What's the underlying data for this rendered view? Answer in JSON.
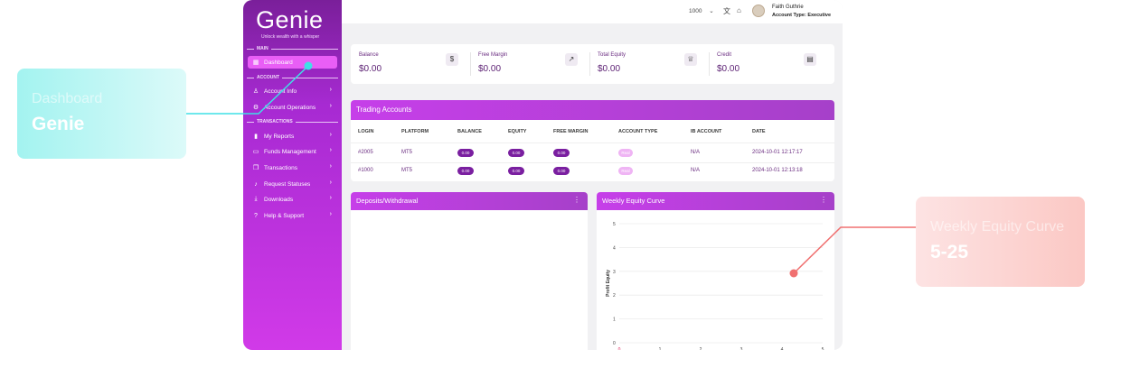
{
  "callouts": {
    "left": {
      "label": "Dashboard",
      "value": "Genie"
    },
    "right": {
      "label": "Weekly Equity Curve",
      "value": "5-25"
    }
  },
  "colors": {
    "accent": "#c63fe9",
    "brand_dark": "#7a1f9a",
    "cyan": "#3fe0e6",
    "coral": "#f07070"
  },
  "sidebar": {
    "logo": "Genie",
    "tagline": "Unlock wealth with a whisper",
    "sections": {
      "main": "MAIN",
      "account": "ACCOUNT",
      "transactions": "TRANSACTIONS"
    },
    "items": [
      {
        "label": "Dashboard",
        "icon": "grid-icon"
      },
      {
        "label": "Account Info",
        "icon": "user-icon"
      },
      {
        "label": "Account Operations",
        "icon": "gear-icon"
      },
      {
        "label": "My Reports",
        "icon": "bar-chart-icon"
      },
      {
        "label": "Funds Management",
        "icon": "wallet-icon"
      },
      {
        "label": "Transactions",
        "icon": "copy-icon"
      },
      {
        "label": "Request Statuses",
        "icon": "bell-icon"
      },
      {
        "label": "Downloads",
        "icon": "download-icon"
      },
      {
        "label": "Help & Support",
        "icon": "help-icon"
      }
    ]
  },
  "header": {
    "account_select": "1000",
    "user_name": "Faith Guthrie",
    "account_type_label": "Account Type:",
    "account_type_value": "Executive"
  },
  "stats": [
    {
      "label": "Balance",
      "value": "$0.00",
      "icon": "dollar-icon"
    },
    {
      "label": "Free Margin",
      "value": "$0.00",
      "icon": "trend-icon"
    },
    {
      "label": "Total Equity",
      "value": "$0.00",
      "icon": "trophy-icon"
    },
    {
      "label": "Credit",
      "value": "$0.00",
      "icon": "card-icon"
    }
  ],
  "trading": {
    "title": "Trading Accounts",
    "columns": [
      "LOGIN",
      "PLATFORM",
      "BALANCE",
      "EQUITY",
      "FREE MARGIN",
      "ACCOUNT TYPE",
      "IB ACCOUNT",
      "DATE"
    ],
    "rows": [
      {
        "login": "#2005",
        "platform": "MT5",
        "balance": "0.00",
        "equity": "0.00",
        "free_margin": "0.00",
        "account_type": "Real",
        "ib_account": "N/A",
        "date": "2024-10-01 12:17:17"
      },
      {
        "login": "#1000",
        "platform": "MT5",
        "balance": "0.00",
        "equity": "0.00",
        "free_margin": "0.00",
        "account_type": "Real",
        "ib_account": "N/A",
        "date": "2024-10-01 12:13:18"
      }
    ]
  },
  "deposits": {
    "title": "Deposits/Withdrawal"
  },
  "weekly": {
    "title": "Weekly Equity Curve"
  },
  "chart_data": {
    "type": "line",
    "title": "Weekly Equity Curve",
    "xlabel": "",
    "ylabel": "Profit Equity",
    "x_ticks": [
      0,
      1,
      2,
      3,
      4,
      5
    ],
    "y_ticks": [
      0,
      1,
      2,
      3,
      4,
      5
    ],
    "xlim": [
      0,
      5
    ],
    "ylim": [
      0,
      5
    ],
    "grid": true,
    "series": []
  }
}
